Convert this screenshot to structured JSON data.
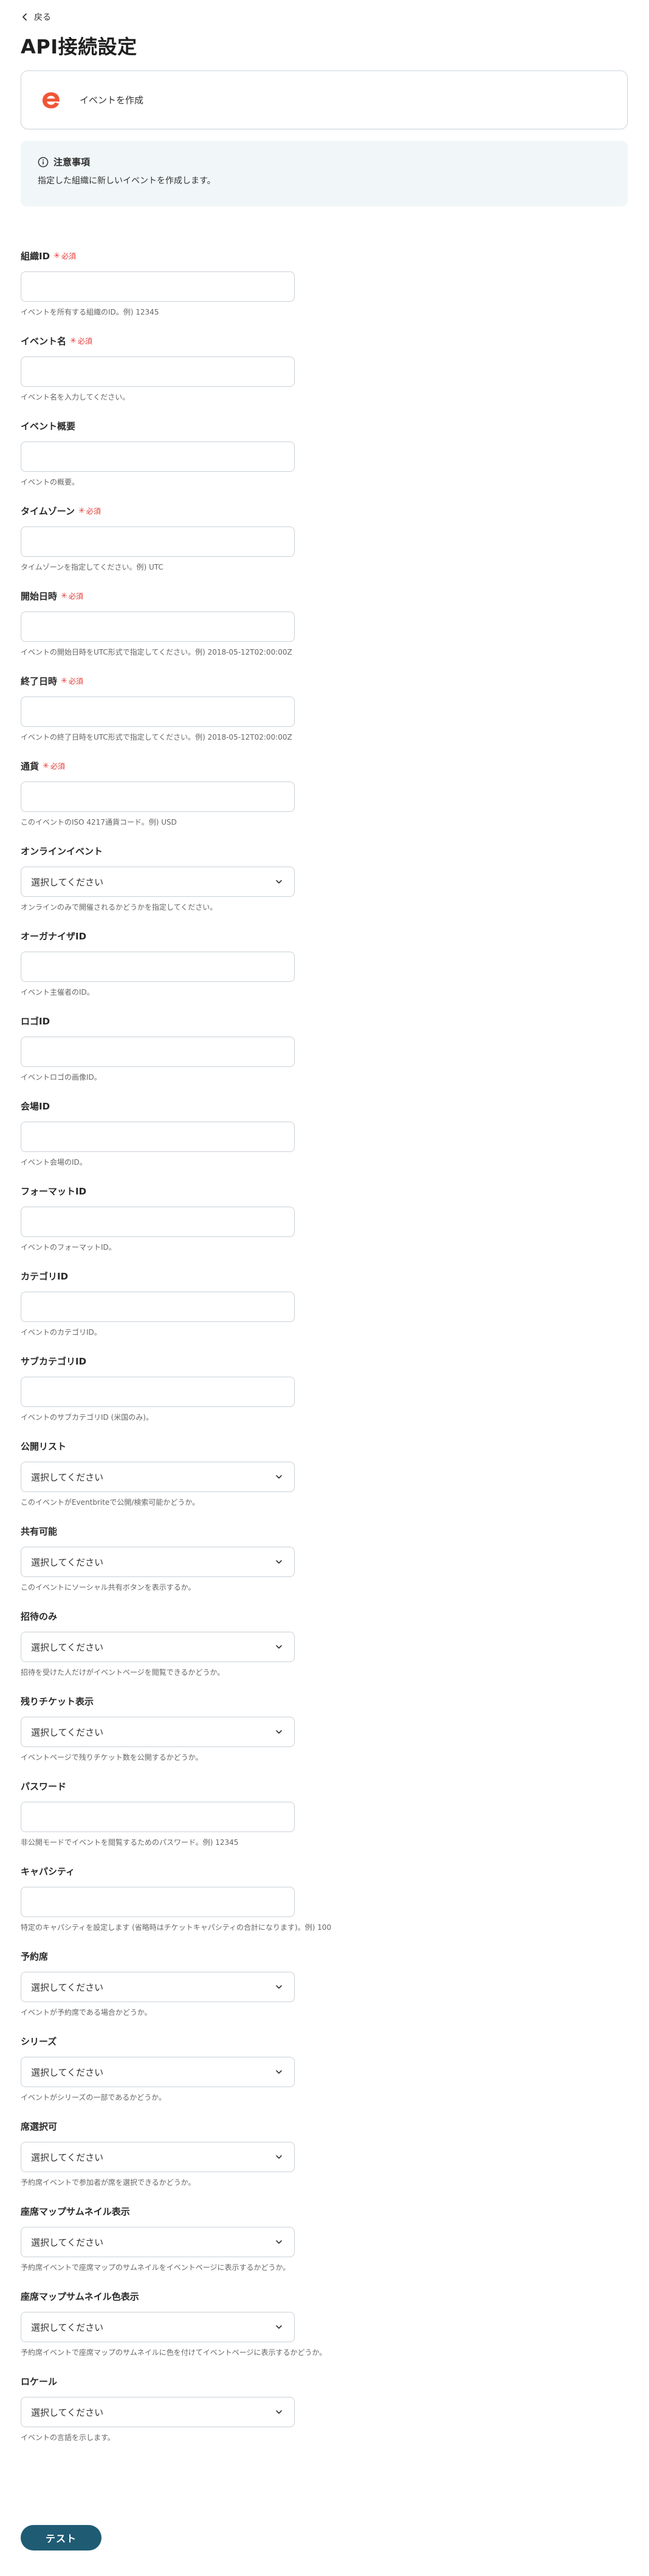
{
  "nav": {
    "back_label": "戻る"
  },
  "page": {
    "title": "API接続設定"
  },
  "action": {
    "label": "イベントを作成",
    "brand_color": "#f05537"
  },
  "notice": {
    "title": "注意事項",
    "body": "指定した組織に新しいイベントを作成します。"
  },
  "required_label": "必須",
  "fields": [
    {
      "label": "組織ID",
      "required": true,
      "type": "text",
      "value": "",
      "help": "イベントを所有する組織のID。例) 12345"
    },
    {
      "label": "イベント名",
      "required": true,
      "type": "text",
      "value": "",
      "help": "イベント名を入力してください。"
    },
    {
      "label": "イベント概要",
      "required": false,
      "type": "text",
      "value": "",
      "help": "イベントの概要。"
    },
    {
      "label": "タイムゾーン",
      "required": true,
      "type": "text",
      "value": "",
      "help": "タイムゾーンを指定してください。例) UTC"
    },
    {
      "label": "開始日時",
      "required": true,
      "type": "text",
      "value": "",
      "help": "イベントの開始日時をUTC形式で指定してください。例) 2018-05-12T02:00:00Z"
    },
    {
      "label": "終了日時",
      "required": true,
      "type": "text",
      "value": "",
      "help": "イベントの終了日時をUTC形式で指定してください。例) 2018-05-12T02:00:00Z"
    },
    {
      "label": "通貨",
      "required": true,
      "type": "text",
      "value": "",
      "help": "このイベントのISO 4217通貨コード。例) USD"
    },
    {
      "label": "オンラインイベント",
      "required": false,
      "type": "select",
      "value": "選択してください",
      "help": "オンラインのみで開催されるかどうかを指定してください。"
    },
    {
      "label": "オーガナイザID",
      "required": false,
      "type": "text",
      "value": "",
      "help": "イベント主催者のID。"
    },
    {
      "label": "ロゴID",
      "required": false,
      "type": "text",
      "value": "",
      "help": "イベントロゴの画像ID。"
    },
    {
      "label": "会場ID",
      "required": false,
      "type": "text",
      "value": "",
      "help": "イベント会場のID。"
    },
    {
      "label": "フォーマットID",
      "required": false,
      "type": "text",
      "value": "",
      "help": "イベントのフォーマットID。"
    },
    {
      "label": "カテゴリID",
      "required": false,
      "type": "text",
      "value": "",
      "help": "イベントのカテゴリID。"
    },
    {
      "label": "サブカテゴリID",
      "required": false,
      "type": "text",
      "value": "",
      "help": "イベントのサブカテゴリID (米国のみ)。"
    },
    {
      "label": "公開リスト",
      "required": false,
      "type": "select",
      "value": "選択してください",
      "help": "このイベントがEventbriteで公開/検索可能かどうか。"
    },
    {
      "label": "共有可能",
      "required": false,
      "type": "select",
      "value": "選択してください",
      "help": "このイベントにソーシャル共有ボタンを表示するか。"
    },
    {
      "label": "招待のみ",
      "required": false,
      "type": "select",
      "value": "選択してください",
      "help": "招待を受けた人だけがイベントページを閲覧できるかどうか。"
    },
    {
      "label": "残りチケット表示",
      "required": false,
      "type": "select",
      "value": "選択してください",
      "help": "イベントページで残りチケット数を公開するかどうか。"
    },
    {
      "label": "パスワード",
      "required": false,
      "type": "text",
      "value": "",
      "help": "非公開モードでイベントを閲覧するためのパスワード。例) 12345"
    },
    {
      "label": "キャパシティ",
      "required": false,
      "type": "text",
      "value": "",
      "help": "特定のキャパシティを設定します (省略時はチケットキャパシティの合計になります)。例) 100"
    },
    {
      "label": "予約席",
      "required": false,
      "type": "select",
      "value": "選択してください",
      "help": "イベントが予約席である場合かどうか。"
    },
    {
      "label": "シリーズ",
      "required": false,
      "type": "select",
      "value": "選択してください",
      "help": "イベントがシリーズの一部であるかどうか。"
    },
    {
      "label": "席選択可",
      "required": false,
      "type": "select",
      "value": "選択してください",
      "help": "予約席イベントで参加者が席を選択できるかどうか。"
    },
    {
      "label": "座席マップサムネイル表示",
      "required": false,
      "type": "select",
      "value": "選択してください",
      "help": "予約席イベントで座席マップのサムネイルをイベントページに表示するかどうか。"
    },
    {
      "label": "座席マップサムネイル色表示",
      "required": false,
      "type": "select",
      "value": "選択してください",
      "help": "予約席イベントで座席マップのサムネイルに色を付けてイベントページに表示するかどうか。"
    },
    {
      "label": "ロケール",
      "required": false,
      "type": "select",
      "value": "選択してください",
      "help": "イベントの言語を示します。"
    }
  ],
  "footer": {
    "test_label": "テスト"
  }
}
